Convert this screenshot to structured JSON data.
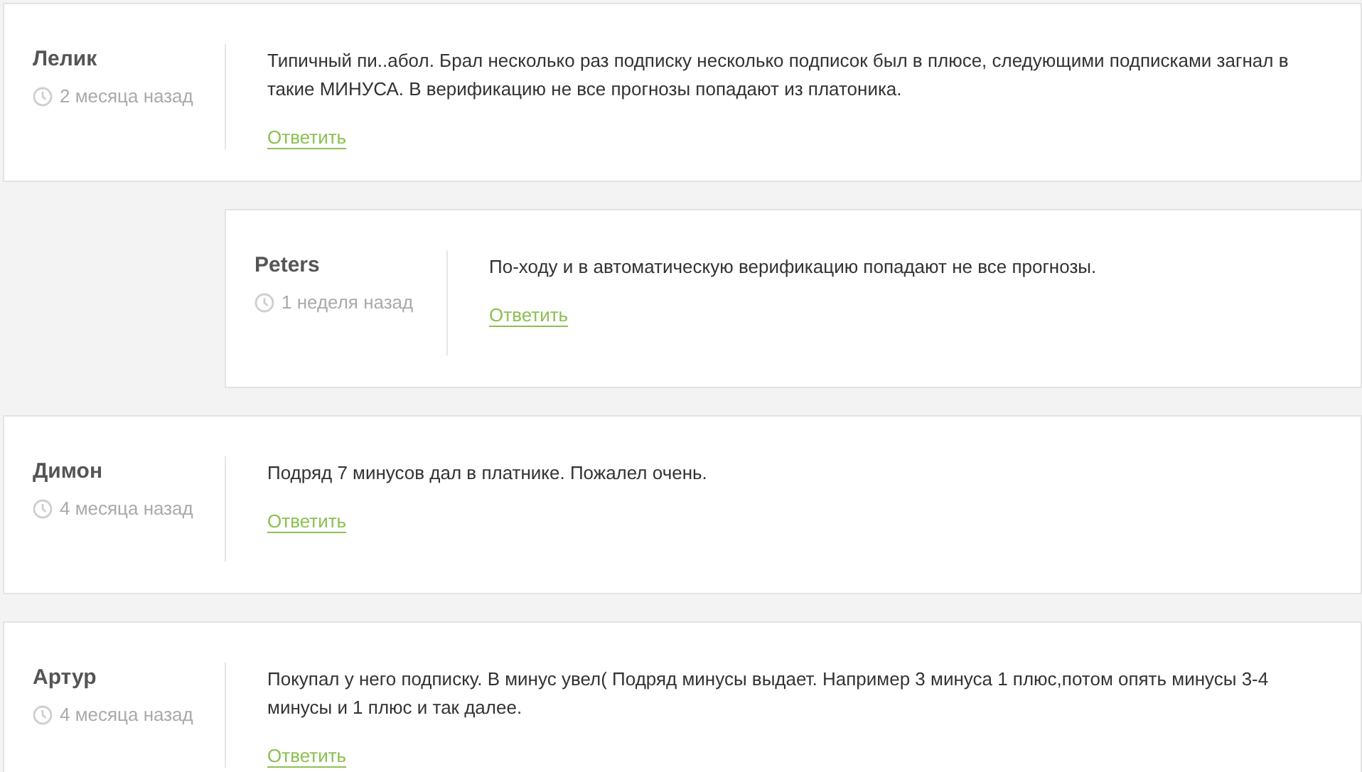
{
  "comments": [
    {
      "author": "Лелик",
      "time": "2 месяца назад",
      "text": "Типичный пи..абол. Брал несколько раз подписку несколько подписок был в плюсе, следующими подписками загнал в такие МИНУСА. В верификацию не все прогнозы попадают из платоника.",
      "reply": "Ответить",
      "children": [
        {
          "author": "Peters",
          "time": "1 неделя назад",
          "text": "По-ходу и в автоматическую верификацию попадают не все прогнозы.",
          "reply": "Ответить"
        }
      ]
    },
    {
      "author": "Димон",
      "time": "4 месяца назад",
      "text": "Подряд 7 минусов дал в платнике. Пожалел очень.",
      "reply": "Ответить"
    },
    {
      "author": "Артур",
      "time": "4 месяца назад",
      "text": "Покупал у него подписку. В минус увел( Подряд минусы выдает. Например 3 минуса 1 плюс,потом опять минусы 3-4 минусы и 1 плюс и так далее.",
      "reply": "Ответить"
    }
  ]
}
